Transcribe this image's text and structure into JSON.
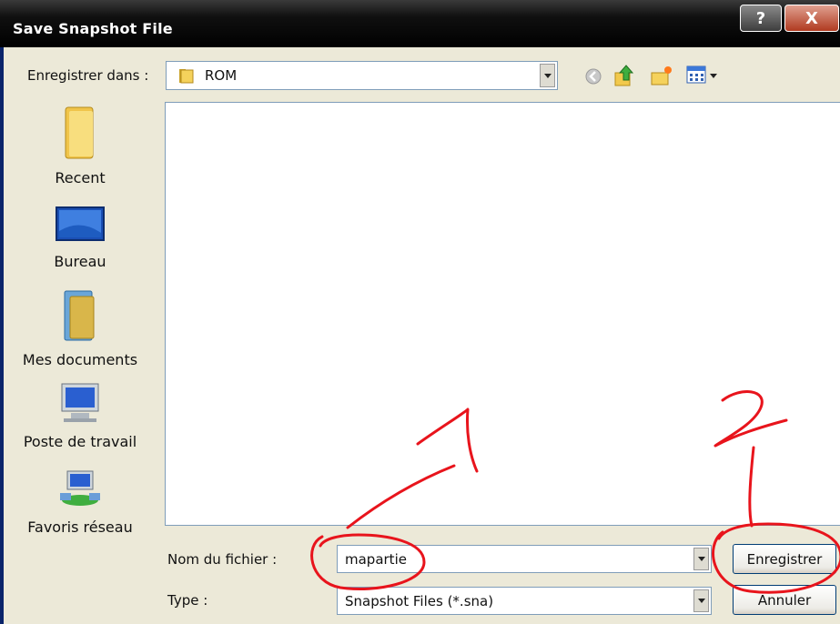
{
  "window": {
    "title": "Save Snapshot File",
    "help_glyph": "?",
    "close_glyph": "X"
  },
  "save_in": {
    "label": "Enregistrer dans :",
    "value": "ROM",
    "icon": "folder-icon"
  },
  "toolbar": {
    "icons": [
      "back-icon",
      "up-folder-icon",
      "new-folder-icon",
      "view-menu-icon"
    ]
  },
  "places": [
    {
      "label": "Recent",
      "icon": "recent-folder-icon"
    },
    {
      "label": "Bureau",
      "icon": "desktop-icon"
    },
    {
      "label": "Mes documents",
      "icon": "my-documents-icon"
    },
    {
      "label": "Poste de travail",
      "icon": "my-computer-icon"
    },
    {
      "label": "Favoris réseau",
      "icon": "network-places-icon"
    }
  ],
  "filename": {
    "label": "Nom du fichier :",
    "value": "mapartie"
  },
  "filetype": {
    "label": "Type :",
    "value": "Snapshot Files (*.sna)"
  },
  "buttons": {
    "save": "Enregistrer",
    "cancel": "Annuler"
  },
  "annotations": {
    "color": "#e8141c",
    "marks": [
      "1",
      "2"
    ]
  },
  "colors": {
    "title_bar": "#000000",
    "dialog_bg": "#ece9d8",
    "input_border": "#7f9db9"
  }
}
